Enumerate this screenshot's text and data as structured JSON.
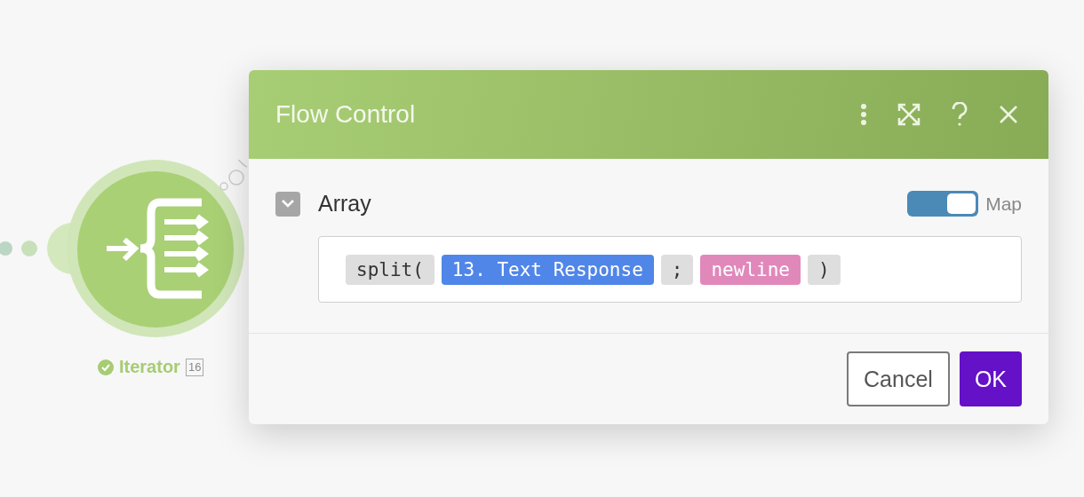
{
  "node": {
    "label": "Iterator",
    "count": "16"
  },
  "dialog": {
    "title": "Flow Control",
    "field": {
      "label": "Array",
      "map": {
        "label": "Map",
        "on": true
      },
      "tokens": [
        {
          "kind": "function",
          "text": "split("
        },
        {
          "kind": "variable",
          "text": "13. Text Response"
        },
        {
          "kind": "function",
          "text": ";"
        },
        {
          "kind": "keyword",
          "text": "newline"
        },
        {
          "kind": "function",
          "text": ")"
        }
      ]
    },
    "buttons": [
      {
        "kind": "secondary",
        "label": "Cancel"
      },
      {
        "kind": "primary",
        "label": "OK"
      }
    ]
  }
}
